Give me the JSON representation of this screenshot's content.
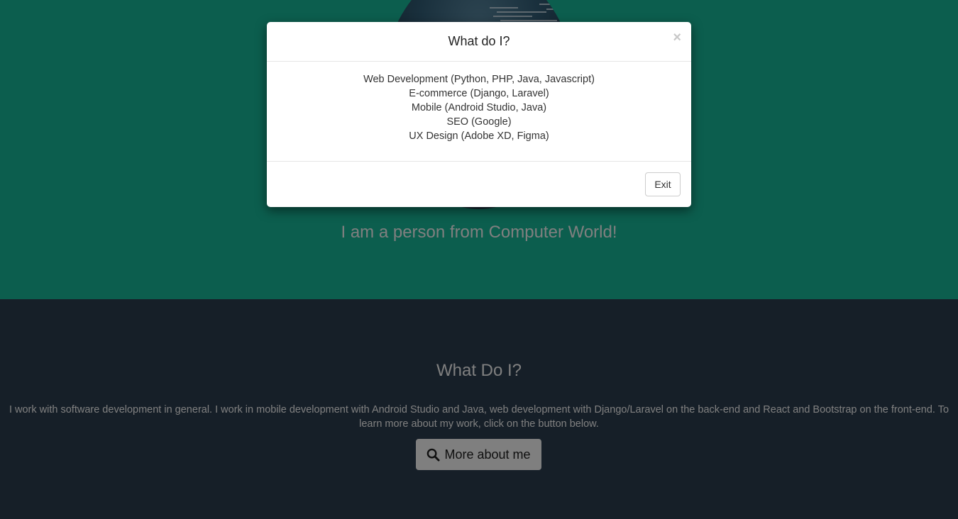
{
  "hero": {
    "tagline": "I am a person from Computer World!"
  },
  "about": {
    "title": "What Do I?",
    "text": "I work with software development in general. I work in mobile development with Android Studio and Java, web development with Django/Laravel on the back-end and React and Bootstrap on the front-end. To learn more about my work, click on the button below.",
    "button_label": "More about me",
    "button_icon": "search-icon"
  },
  "modal": {
    "title": "What do I?",
    "close_glyph": "×",
    "items": [
      "Web Development (Python, PHP, Java, Javascript)",
      "E-commerce (Django, Laravel)",
      "Mobile (Android Studio, Java)",
      "SEO (Google)",
      "UX Design (Adobe XD, Figma)"
    ],
    "exit_label": "Exit"
  },
  "colors": {
    "hero_background": "#18bc9c",
    "about_background": "#2c3e50",
    "backdrop": "rgba(0,0,0,0.5)"
  }
}
